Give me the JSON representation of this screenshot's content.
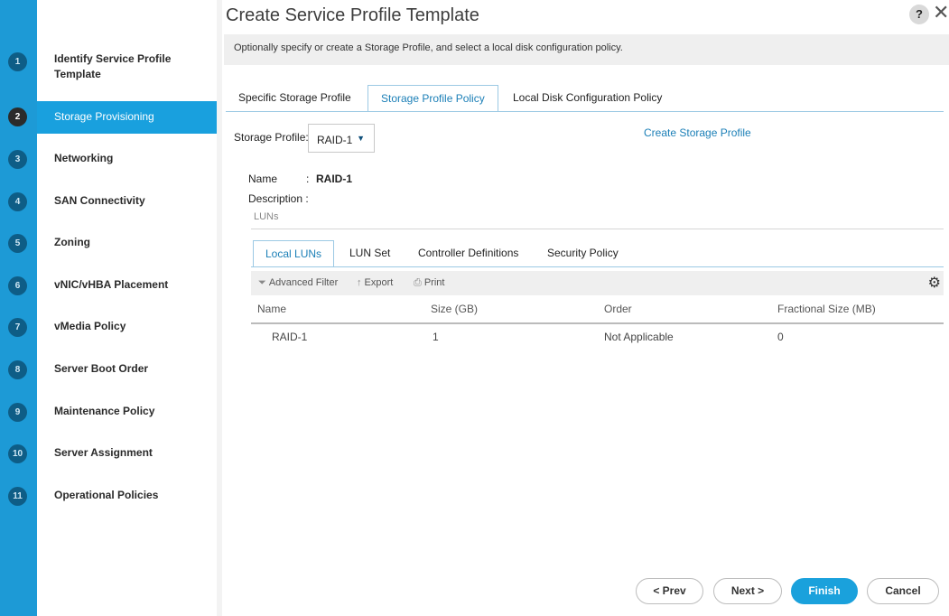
{
  "window": {
    "title": "Create Service Profile Template",
    "help_label": "?",
    "close_label": "✕"
  },
  "wizard": {
    "steps": [
      {
        "num": "1",
        "label": "Identify Service Profile Template",
        "active": false
      },
      {
        "num": "2",
        "label": "Storage Provisioning",
        "active": true
      },
      {
        "num": "3",
        "label": "Networking",
        "active": false
      },
      {
        "num": "4",
        "label": "SAN Connectivity",
        "active": false
      },
      {
        "num": "5",
        "label": "Zoning",
        "active": false
      },
      {
        "num": "6",
        "label": "vNIC/vHBA Placement",
        "active": false
      },
      {
        "num": "7",
        "label": "vMedia Policy",
        "active": false
      },
      {
        "num": "8",
        "label": "Server Boot Order",
        "active": false
      },
      {
        "num": "9",
        "label": "Maintenance Policy",
        "active": false
      },
      {
        "num": "10",
        "label": "Server Assignment",
        "active": false
      },
      {
        "num": "11",
        "label": "Operational Policies",
        "active": false
      }
    ]
  },
  "info": "Optionally specify or create a Storage Profile, and select a local disk configuration policy.",
  "tabs": [
    {
      "label": "Specific Storage Profile",
      "active": false
    },
    {
      "label": "Storage Profile Policy",
      "active": true
    },
    {
      "label": "Local Disk Configuration Policy",
      "active": false
    }
  ],
  "storage_profile": {
    "label": "Storage Profile:",
    "value": "RAID-1",
    "arrow": "▼",
    "create_link": "Create Storage Profile"
  },
  "details": {
    "name_label": "Name",
    "name_sep": ":",
    "name_value": "RAID-1",
    "description_label": "Description :",
    "luns_label": "LUNs"
  },
  "inner_tabs": [
    {
      "label": "Local LUNs",
      "active": true
    },
    {
      "label": "LUN Set",
      "active": false
    },
    {
      "label": "Controller Definitions",
      "active": false
    },
    {
      "label": "Security Policy",
      "active": false
    }
  ],
  "toolbar": {
    "filter_label": "Advanced Filter",
    "export_label": "Export",
    "print_label": "Print"
  },
  "table": {
    "columns": [
      "Name",
      "Size (GB)",
      "Order",
      "Fractional Size (MB)"
    ],
    "rows": [
      [
        "RAID-1",
        "1",
        "Not Applicable",
        "0"
      ]
    ]
  },
  "footer": {
    "prev_label": "< Prev",
    "next_label": "Next >",
    "finish_label": "Finish",
    "cancel_label": "Cancel"
  },
  "colors": {
    "accent": "#1d9ad6",
    "active_step": "#19a0de",
    "link": "#1b7fb7"
  }
}
